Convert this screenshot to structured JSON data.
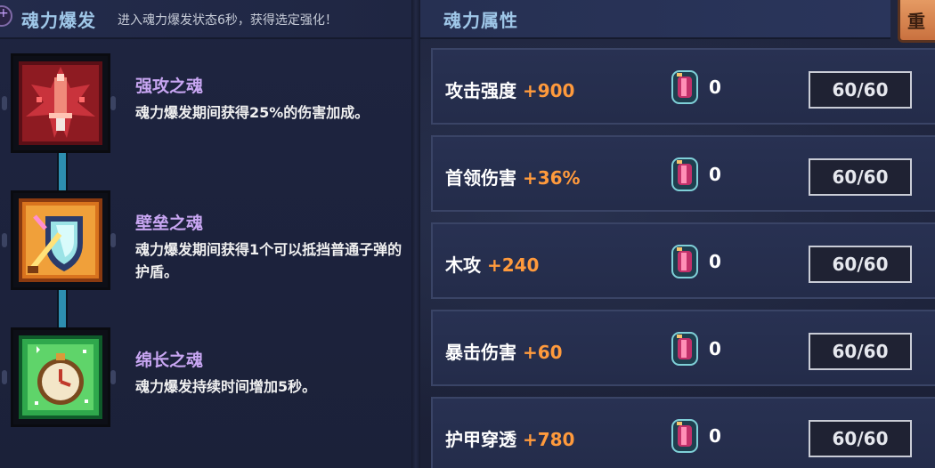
{
  "left_panel": {
    "title": "魂力爆发",
    "subtitle": "进入魂力爆发状态6秒，获得选定强化！",
    "skills": [
      {
        "name": "强攻之魂",
        "desc": "魂力爆发期间获得25%的伤害加成。",
        "icon": "red-sword-rune-icon"
      },
      {
        "name": "壁垒之魂",
        "desc": "魂力爆发期间获得1个可以抵挡普通子弹的护盾。",
        "icon": "shield-sword-rune-icon"
      },
      {
        "name": "绵长之魂",
        "desc": "魂力爆发持续时间增加5秒。",
        "icon": "stopwatch-rune-icon"
      }
    ]
  },
  "right_panel": {
    "title": "魂力属性",
    "reset_label": "重",
    "attributes": [
      {
        "label": "攻击强度",
        "bonus": "+900",
        "gem_count": "0",
        "level": "60/60"
      },
      {
        "label": "首领伤害",
        "bonus": "+36%",
        "gem_count": "0",
        "level": "60/60"
      },
      {
        "label": "木攻",
        "bonus": "+240",
        "gem_count": "0",
        "level": "60/60"
      },
      {
        "label": "暴击伤害",
        "bonus": "+60",
        "gem_count": "0",
        "level": "60/60"
      },
      {
        "label": "护甲穿透",
        "bonus": "+780",
        "gem_count": "0",
        "level": "60/60"
      }
    ]
  },
  "colors": {
    "title": "#9fc7e8",
    "skill_name": "#c8a6f2",
    "bonus": "#ff9a3c",
    "connector": "#2d8fb0",
    "reset_button": "#e59a63"
  }
}
